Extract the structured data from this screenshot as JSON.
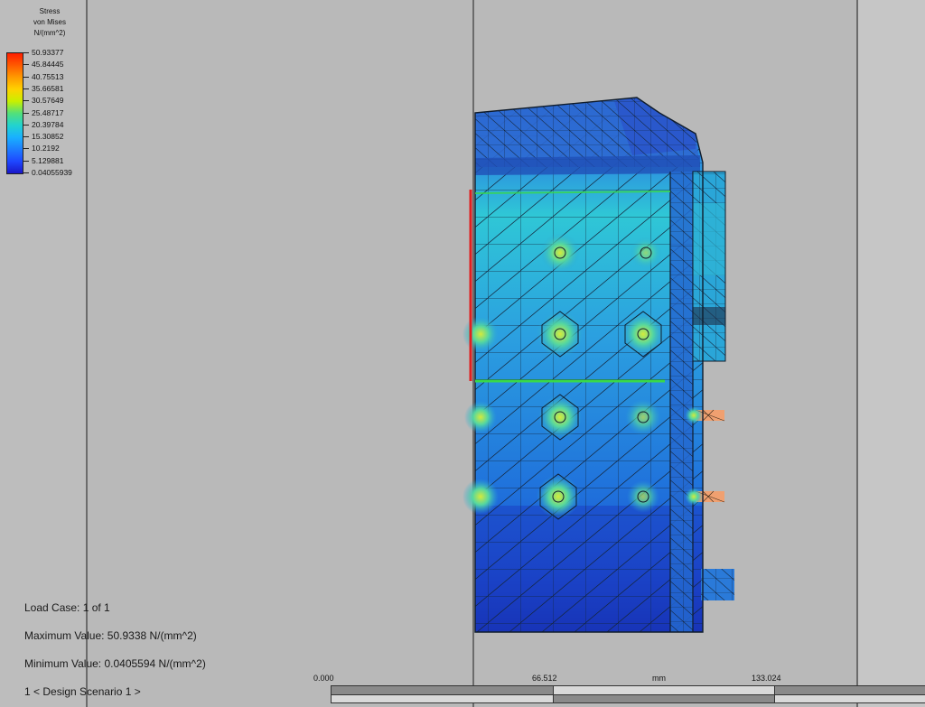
{
  "legend": {
    "title_lines": [
      "Stress",
      "von Mises",
      "N/(mm^2)"
    ],
    "values": [
      "50.93377",
      "45.84445",
      "40.75513",
      "35.66581",
      "30.57649",
      "25.48717",
      "20.39784",
      "15.30852",
      "10.2192",
      "5.129881",
      "0.04055939"
    ],
    "gradient_colors": [
      "#ff1e00",
      "#ff9a00",
      "#c8f000",
      "#22d3cf",
      "#1d7dff",
      "#1a17c8"
    ]
  },
  "info": {
    "load_case": "Load Case:  1 of 1",
    "max_value": "Maximum Value: 50.9338 N/(mm^2)",
    "min_value": "Minimum Value: 0.0405594 N/(mm^2)",
    "design_scenario": "1 < Design Scenario 1 >"
  },
  "scale": {
    "start": "0.000",
    "mid": "66.512",
    "unit": "mm",
    "end": "133.024"
  },
  "colors": {
    "viewport_bg": "#b9b9b9",
    "mesh_line": "#1a2a3a",
    "part_low": "#1f5fd8",
    "part_mid": "#2aa6d8",
    "constraint_red": "#e02020",
    "edge_green": "#39d94a"
  }
}
